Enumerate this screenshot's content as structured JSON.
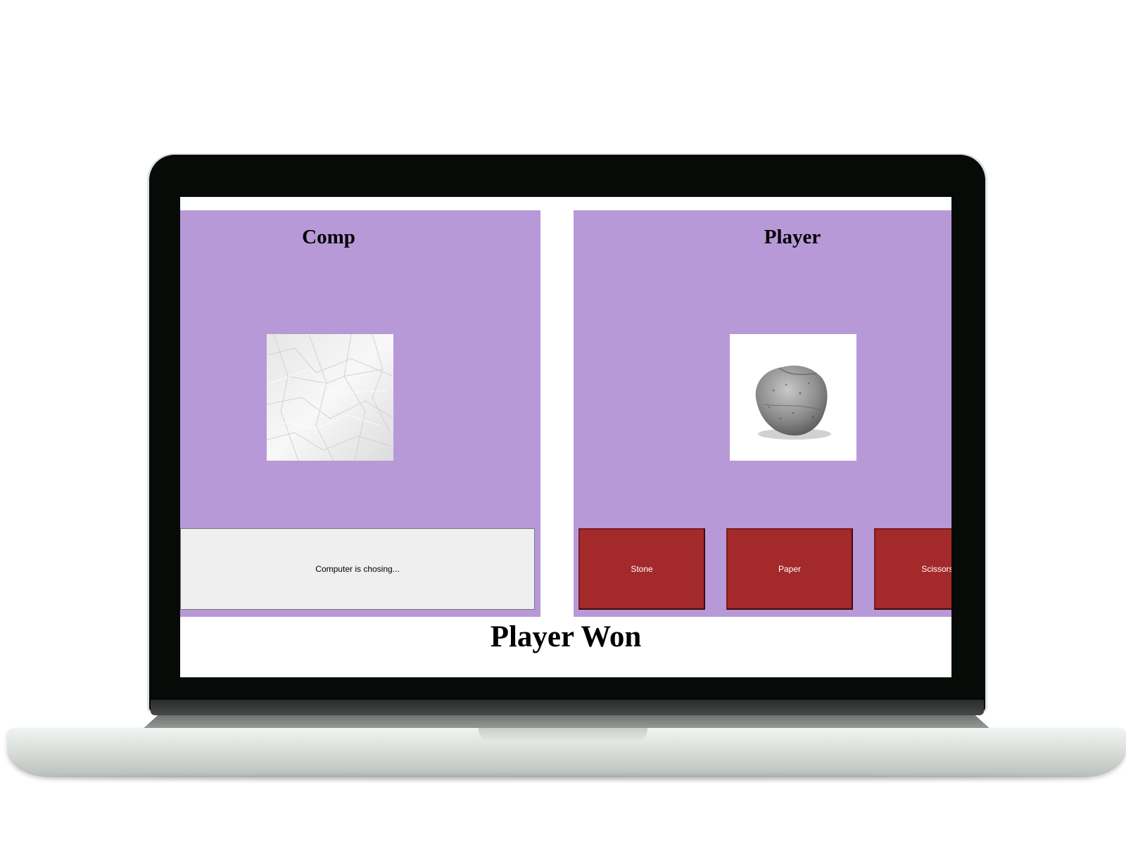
{
  "comp": {
    "title": "Comp",
    "choice_image": "crumpled-paper",
    "status": "Computer is chosing..."
  },
  "player": {
    "title": "Player",
    "choice_image": "stone",
    "buttons": [
      {
        "label": "Stone"
      },
      {
        "label": "Paper"
      },
      {
        "label": "Scissors"
      }
    ]
  },
  "result": "Player Won",
  "colors": {
    "panel_bg": "#b899d8",
    "button_bg": "#a4292b",
    "status_bg": "#efefef"
  }
}
